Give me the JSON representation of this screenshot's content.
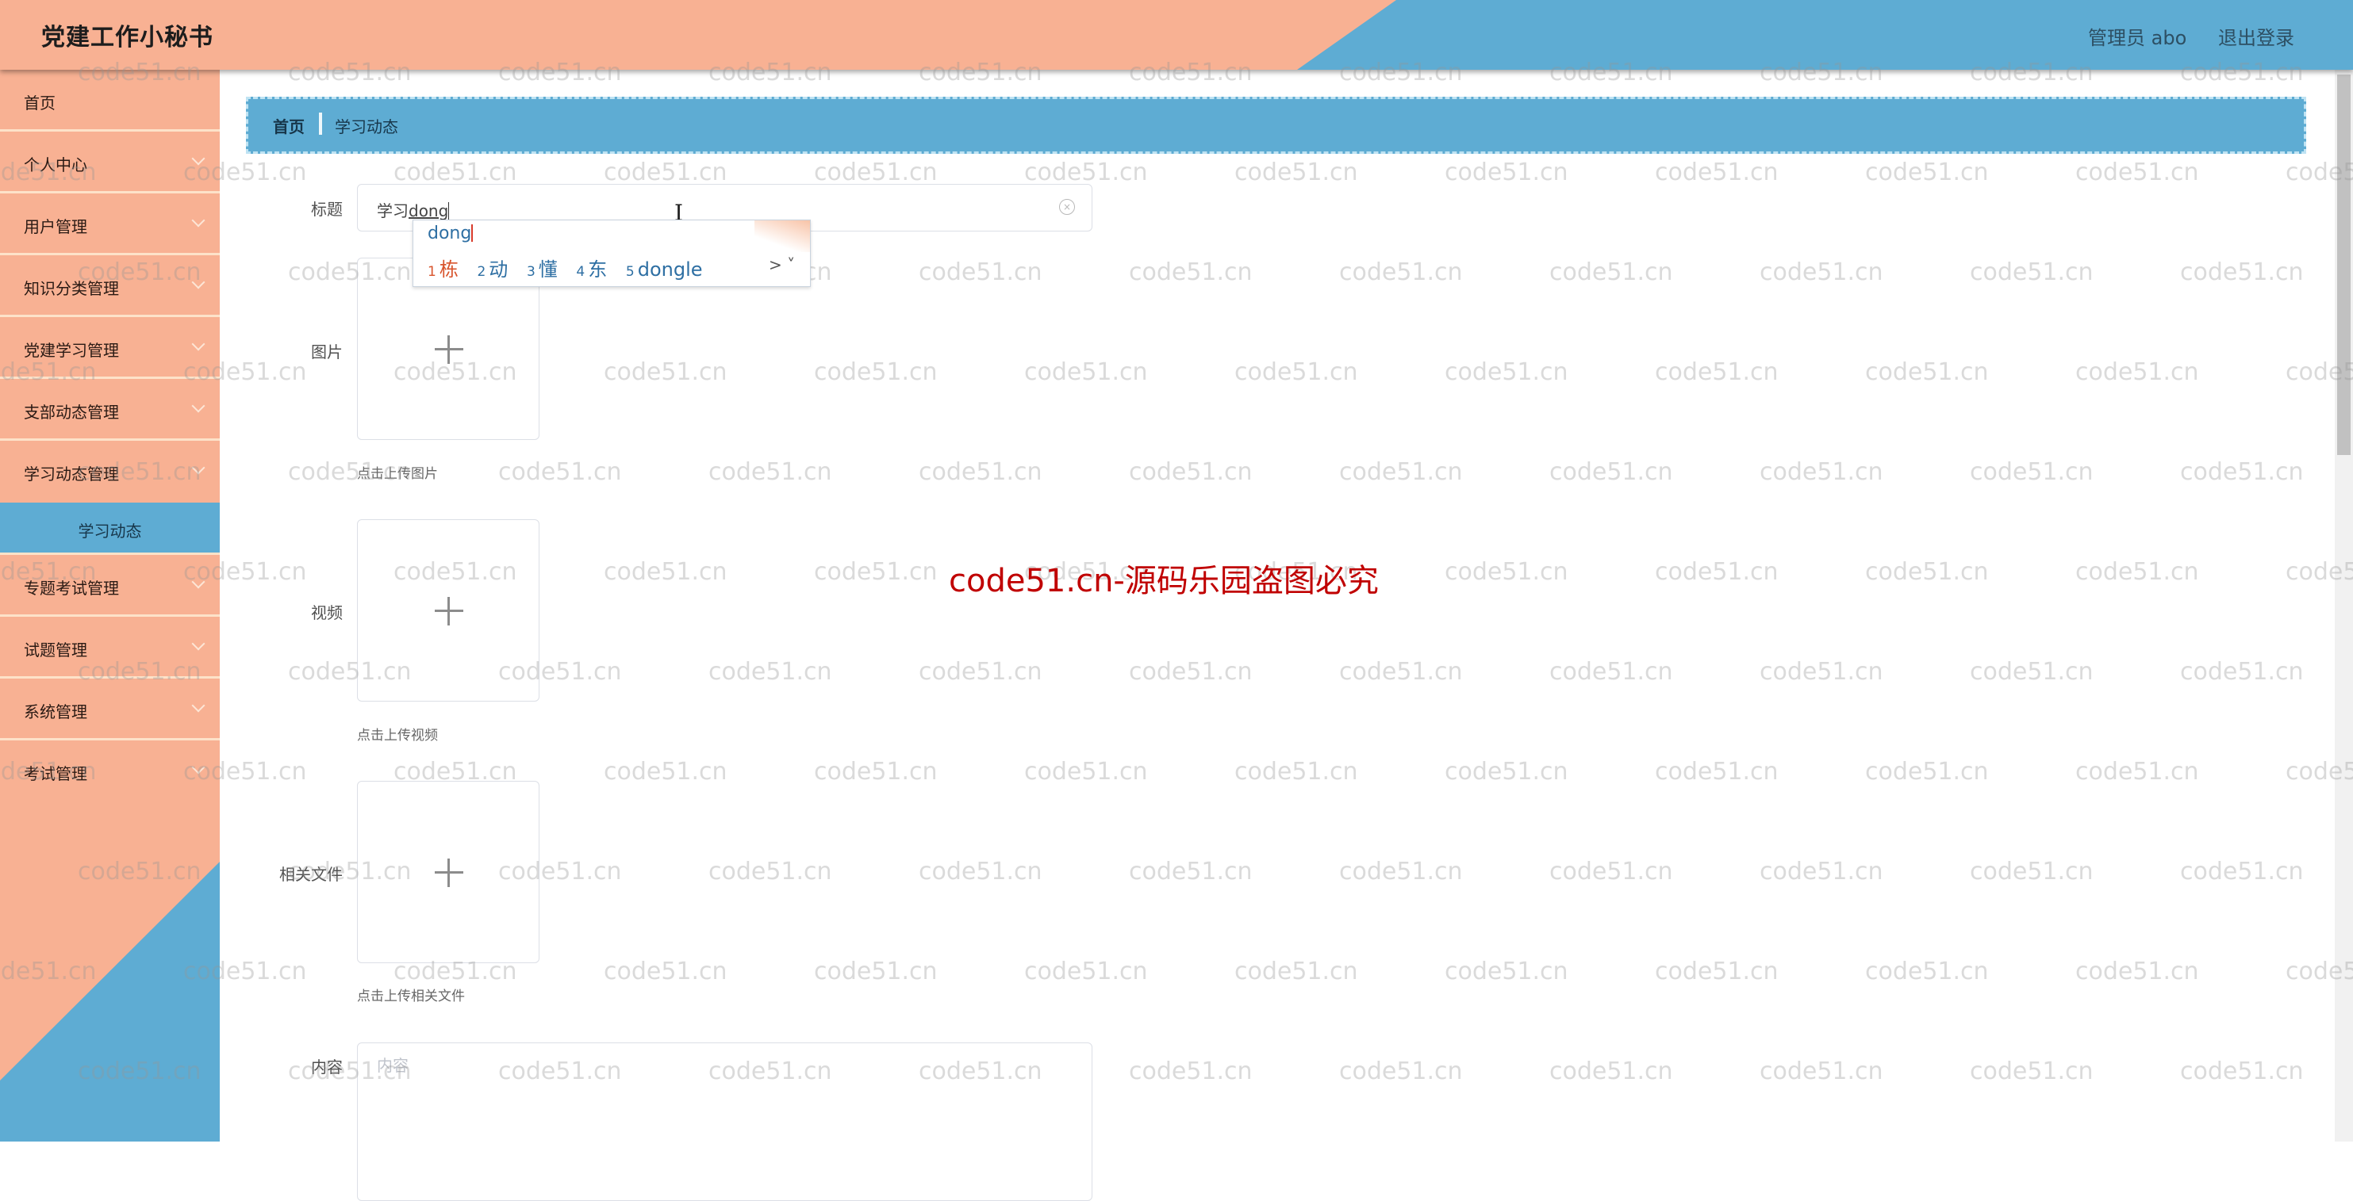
{
  "header": {
    "app_title": "党建工作小秘书",
    "user_label": "管理员 abo",
    "logout_label": "退出登录"
  },
  "sidebar": {
    "items": [
      {
        "label": "首页",
        "has_children": false
      },
      {
        "label": "个人中心",
        "has_children": true
      },
      {
        "label": "用户管理",
        "has_children": true
      },
      {
        "label": "知识分类管理",
        "has_children": true
      },
      {
        "label": "党建学习管理",
        "has_children": true
      },
      {
        "label": "支部动态管理",
        "has_children": true
      },
      {
        "label": "学习动态管理",
        "has_children": true,
        "expanded": true
      },
      {
        "label": "专题考试管理",
        "has_children": true
      },
      {
        "label": "试题管理",
        "has_children": true
      },
      {
        "label": "系统管理",
        "has_children": true
      },
      {
        "label": "考试管理",
        "has_children": true
      }
    ],
    "active_subitem": "学习动态"
  },
  "breadcrumb": {
    "home": "首页",
    "current": "学习动态"
  },
  "form": {
    "title": {
      "label": "标题",
      "value_committed": "学习",
      "value_composing": "dong"
    },
    "image": {
      "label": "图片",
      "hint": "点击上传图片"
    },
    "video": {
      "label": "视频",
      "hint": "点击上传视频"
    },
    "file": {
      "label": "相关文件",
      "hint": "点击上传相关文件"
    },
    "content": {
      "label": "内容",
      "placeholder": "内容"
    }
  },
  "ime": {
    "composition": "dong",
    "candidates": [
      {
        "num": "1",
        "text": "栋",
        "selected": true
      },
      {
        "num": "2",
        "text": "动"
      },
      {
        "num": "3",
        "text": "懂"
      },
      {
        "num": "4",
        "text": "东"
      },
      {
        "num": "5",
        "text": "dongle"
      }
    ],
    "more": "> ˅"
  },
  "notice": "code51.cn-源码乐园盗图必究",
  "watermark_text": "code51.cn",
  "colors": {
    "peach": "#f8b193",
    "blue": "#5eacd3",
    "notice_red": "#c00000"
  }
}
